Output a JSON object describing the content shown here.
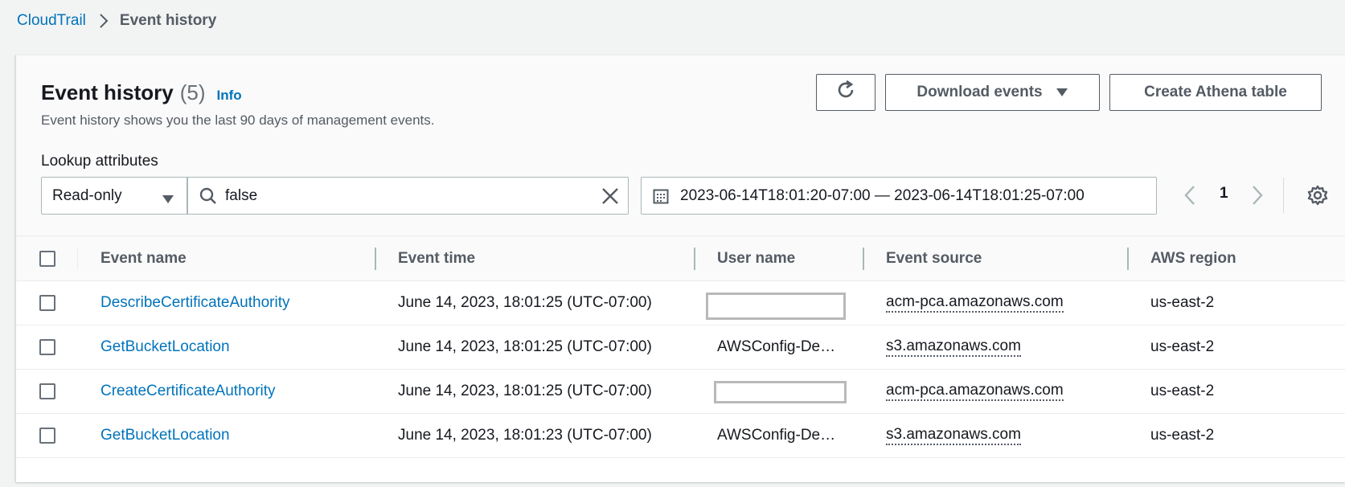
{
  "breadcrumb": {
    "root": "CloudTrail",
    "current": "Event history"
  },
  "header": {
    "title": "Event history",
    "count": "(5)",
    "info": "Info",
    "subtitle": "Event history shows you the last 90 days of management events."
  },
  "actions": {
    "refresh_icon": "refresh-icon",
    "download_label": "Download events",
    "athena_label": "Create Athena table"
  },
  "filters": {
    "lookup_label": "Lookup attributes",
    "attribute": "Read-only",
    "search_value": "false",
    "date_range": "2023-06-14T18:01:20-07:00 — 2023-06-14T18:01:25-07:00"
  },
  "pagination": {
    "current_page": "1"
  },
  "table": {
    "columns": [
      "Event name",
      "Event time",
      "User name",
      "Event source",
      "AWS region"
    ],
    "rows": [
      {
        "event_name": "DescribeCertificateAuthority",
        "event_time": "June 14, 2023, 18:01:25 (UTC-07:00)",
        "user_name": "",
        "event_source": "acm-pca.amazonaws.com",
        "region": "us-east-2"
      },
      {
        "event_name": "GetBucketLocation",
        "event_time": "June 14, 2023, 18:01:25 (UTC-07:00)",
        "user_name": "AWSConfig-De…",
        "event_source": "s3.amazonaws.com",
        "region": "us-east-2"
      },
      {
        "event_name": "CreateCertificateAuthority",
        "event_time": "June 14, 2023, 18:01:25 (UTC-07:00)",
        "user_name": "",
        "event_source": "acm-pca.amazonaws.com",
        "region": "us-east-2"
      },
      {
        "event_name": "GetBucketLocation",
        "event_time": "June 14, 2023, 18:01:23 (UTC-07:00)",
        "user_name": "AWSConfig-De…",
        "event_source": "s3.amazonaws.com",
        "region": "us-east-2"
      }
    ]
  },
  "colors": {
    "link": "#0073bb",
    "text": "#16191f",
    "muted": "#545b64",
    "border": "#aab7b8"
  }
}
